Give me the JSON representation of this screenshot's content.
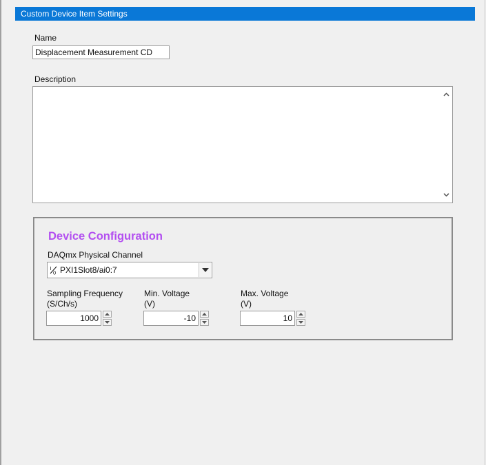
{
  "window": {
    "title": "Custom Device Item Settings"
  },
  "name_field": {
    "label": "Name",
    "value": "Displacement Measurement CD"
  },
  "description_field": {
    "label": "Description",
    "value": ""
  },
  "device_configuration": {
    "title": "Device Configuration",
    "title_color": "#b34ff0",
    "physical_channel": {
      "label": "DAQmx Physical Channel",
      "value": "PXI1Slot8/ai0:7"
    },
    "sampling_frequency": {
      "label_line1": "Sampling Frequency",
      "label_line2": "(S/Ch/s)",
      "value": "1000"
    },
    "min_voltage": {
      "label_line1": "Min. Voltage",
      "label_line2": "(V)",
      "value": "-10"
    },
    "max_voltage": {
      "label_line1": "Max. Voltage",
      "label_line2": "(V)",
      "value": "10"
    }
  },
  "colors": {
    "title_bar": "#0a78d7",
    "background": "#f0f0f0"
  }
}
